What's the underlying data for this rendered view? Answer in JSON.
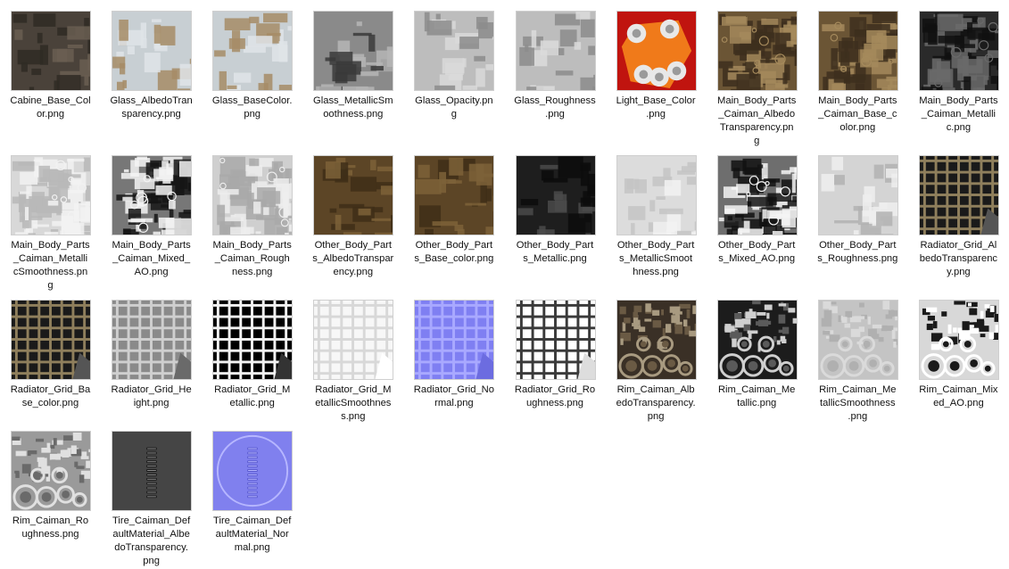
{
  "files": [
    {
      "name": "Cabine_Base_Color.png",
      "icon": "texture-dark-brown",
      "thumb": {
        "type": "panels",
        "bg": "#4a423a",
        "fg": "#2f2a25",
        "accent": "#6a5e52"
      }
    },
    {
      "name": "Glass_AlbedoTransparency.png",
      "icon": "texture-pale-blue",
      "thumb": {
        "type": "panels",
        "bg": "#c8cfd3",
        "fg": "#dfe4e7",
        "accent": "#a68c66"
      }
    },
    {
      "name": "Glass_BaseColor.png",
      "icon": "texture-pale-blue",
      "thumb": {
        "type": "panels",
        "bg": "#c8cfd3",
        "fg": "#dfe4e7",
        "accent": "#a68c66"
      }
    },
    {
      "name": "Glass_MetallicSmoothness.png",
      "icon": "texture-grey",
      "thumb": {
        "type": "panels",
        "bg": "#8a8a8a",
        "fg": "#b5b5b5",
        "accent": "#3a3a3a"
      }
    },
    {
      "name": "Glass_Opacity.png",
      "icon": "texture-light-grey",
      "thumb": {
        "type": "panels",
        "bg": "#bdbdbd",
        "fg": "#d9d9d9",
        "accent": "#8c8c8c"
      }
    },
    {
      "name": "Glass_Roughness.png",
      "icon": "texture-light-grey",
      "thumb": {
        "type": "panels",
        "bg": "#bdbdbd",
        "fg": "#dcdcdc",
        "accent": "#8c8c8c"
      }
    },
    {
      "name": "Light_Base_Color.png",
      "icon": "texture-red-orange",
      "thumb": {
        "type": "light",
        "bg": "#c0140f",
        "fg": "#f07a1a",
        "accent": "#e8e8e8"
      }
    },
    {
      "name": "Main_Body_Parts_Caiman_AlbedoTransparency.png",
      "icon": "texture-brown",
      "thumb": {
        "type": "detail",
        "bg": "#6b5535",
        "fg": "#3d2f1d",
        "accent": "#a58a5c"
      }
    },
    {
      "name": "Main_Body_Parts_Caiman_Base_color.png",
      "icon": "texture-brown",
      "thumb": {
        "type": "detail",
        "bg": "#6b5535",
        "fg": "#3d2f1d",
        "accent": "#a58a5c"
      }
    },
    {
      "name": "Main_Body_Parts_Caiman_Metallic.png",
      "icon": "texture-dark",
      "thumb": {
        "type": "detail",
        "bg": "#2a2a2a",
        "fg": "#111111",
        "accent": "#6a6a6a"
      }
    },
    {
      "name": "Main_Body_Parts_Caiman_MetallicSmoothness.png",
      "icon": "texture-light",
      "thumb": {
        "type": "detail",
        "bg": "#d8d8d8",
        "fg": "#b8b8b8",
        "accent": "#f2f2f2"
      }
    },
    {
      "name": "Main_Body_Parts_Caiman_Mixed_AO.png",
      "icon": "texture-bw",
      "thumb": {
        "type": "detail",
        "bg": "#777777",
        "fg": "#151515",
        "accent": "#f4f4f4"
      }
    },
    {
      "name": "Main_Body_Parts_Caiman_Roughness.png",
      "icon": "texture-light",
      "thumb": {
        "type": "detail",
        "bg": "#cfcfcf",
        "fg": "#a9a9a9",
        "accent": "#ededed"
      }
    },
    {
      "name": "Other_Body_Parts_AlbedoTransparency.png",
      "icon": "texture-brown",
      "thumb": {
        "type": "panels",
        "bg": "#5c4526",
        "fg": "#3e2e18",
        "accent": "#7d6238"
      }
    },
    {
      "name": "Other_Body_Parts_Base_color.png",
      "icon": "texture-brown",
      "thumb": {
        "type": "panels",
        "bg": "#5c4526",
        "fg": "#3e2e18",
        "accent": "#7d6238"
      }
    },
    {
      "name": "Other_Body_Parts_Metallic.png",
      "icon": "texture-dark",
      "thumb": {
        "type": "panels",
        "bg": "#1e1e1e",
        "fg": "#0c0c0c",
        "accent": "#4a4a4a"
      }
    },
    {
      "name": "Other_Body_Parts_MetallicSmoothness.png",
      "icon": "texture-light",
      "thumb": {
        "type": "panels",
        "bg": "#dcdcdc",
        "fg": "#c4c4c4",
        "accent": "#f2f2f2"
      }
    },
    {
      "name": "Other_Body_Parts_Mixed_AO.png",
      "icon": "texture-bw",
      "thumb": {
        "type": "detail",
        "bg": "#6e6e6e",
        "fg": "#121212",
        "accent": "#f4f4f4"
      }
    },
    {
      "name": "Other_Body_Parts_Roughness.png",
      "icon": "texture-light",
      "thumb": {
        "type": "panels",
        "bg": "#d4d4d4",
        "fg": "#b2b2b2",
        "accent": "#efefef"
      }
    },
    {
      "name": "Radiator_Grid_AlbedoTransparency.png",
      "icon": "texture-grid",
      "thumb": {
        "type": "grid",
        "bg": "#1a1a1a",
        "fg": "#8f7f5c",
        "accent": "#555555"
      }
    },
    {
      "name": "Radiator_Grid_Base_color.png",
      "icon": "texture-grid",
      "thumb": {
        "type": "grid",
        "bg": "#1a1a1a",
        "fg": "#8f7f5c",
        "accent": "#555555"
      }
    },
    {
      "name": "Radiator_Grid_Height.png",
      "icon": "texture-grid-grey",
      "thumb": {
        "type": "grid",
        "bg": "#8a8a8a",
        "fg": "#cfcfcf",
        "accent": "#6a6a6a"
      }
    },
    {
      "name": "Radiator_Grid_Metallic.png",
      "icon": "texture-grid-bw",
      "thumb": {
        "type": "grid",
        "bg": "#000000",
        "fg": "#f2f2f2",
        "accent": "#333333"
      }
    },
    {
      "name": "Radiator_Grid_MetallicSmoothness.png",
      "icon": "texture-grid-white",
      "thumb": {
        "type": "grid",
        "bg": "#f7f7f7",
        "fg": "#d8d8d8",
        "accent": "#ffffff"
      }
    },
    {
      "name": "Radiator_Grid_Normal.png",
      "icon": "texture-normal-grid",
      "thumb": {
        "type": "grid",
        "bg": "#7f7ff2",
        "fg": "#a9a9ff",
        "accent": "#6c6ce0"
      }
    },
    {
      "name": "Radiator_Grid_Roughness.png",
      "icon": "texture-grid-dark-lines",
      "thumb": {
        "type": "grid",
        "bg": "#ffffff",
        "fg": "#3a3a3a",
        "accent": "#dddddd"
      }
    },
    {
      "name": "Rim_Caiman_AlbedoTransparency.png",
      "icon": "texture-rim",
      "thumb": {
        "type": "rim",
        "bg": "#3a3026",
        "fg": "#6a5a44",
        "accent": "#a89a80"
      }
    },
    {
      "name": "Rim_Caiman_Metallic.png",
      "icon": "texture-rim-dark",
      "thumb": {
        "type": "rim",
        "bg": "#1c1c1c",
        "fg": "#5a5a5a",
        "accent": "#cfcfcf"
      }
    },
    {
      "name": "Rim_Caiman_MetallicSmoothness.png",
      "icon": "texture-rim-light",
      "thumb": {
        "type": "rim",
        "bg": "#c4c4c4",
        "fg": "#b0b0b0",
        "accent": "#dadada"
      }
    },
    {
      "name": "Rim_Caiman_Mixed_AO.png",
      "icon": "texture-rim-bw",
      "thumb": {
        "type": "rim",
        "bg": "#d8d8d8",
        "fg": "#1a1a1a",
        "accent": "#ffffff"
      }
    },
    {
      "name": "Rim_Caiman_Roughness.png",
      "icon": "texture-rim-grey",
      "thumb": {
        "type": "rim",
        "bg": "#9a9a9a",
        "fg": "#6a6a6a",
        "accent": "#e0e0e0"
      }
    },
    {
      "name": "Tire_Caiman_DefaultMaterial_AlbedoTransparency.png",
      "icon": "texture-tire",
      "thumb": {
        "type": "tire",
        "bg": "#454545",
        "fg": "#1a1a1a",
        "accent": "#8a8a8a"
      }
    },
    {
      "name": "Tire_Caiman_DefaultMaterial_Normal.png",
      "icon": "texture-tire-normal",
      "thumb": {
        "type": "tire",
        "bg": "#8080ee",
        "fg": "#5c5cd0",
        "accent": "#b6b6ff"
      }
    }
  ],
  "labels": [
    [
      "Cabine_Base_Col",
      "or.png"
    ],
    [
      "Glass_AlbedoTran",
      "sparency.png"
    ],
    [
      "Glass_BaseColor.",
      "png"
    ],
    [
      "Glass_MetallicSm",
      "oothness.png"
    ],
    [
      "Glass_Opacity.pn",
      "g"
    ],
    [
      "Glass_Roughness",
      ".png"
    ],
    [
      "Light_Base_Color",
      ".png"
    ],
    [
      "Main_Body_Parts",
      "_Caiman_Albedo",
      "Transparency.pn",
      "g"
    ],
    [
      "Main_Body_Parts",
      "_Caiman_Base_c",
      "olor.png"
    ],
    [
      "Main_Body_Parts",
      "_Caiman_Metalli",
      "c.png"
    ],
    [
      "Main_Body_Parts",
      "_Caiman_Metalli",
      "cSmoothness.pn",
      "g"
    ],
    [
      "Main_Body_Parts",
      "_Caiman_Mixed_",
      "AO.png"
    ],
    [
      "Main_Body_Parts",
      "_Caiman_Rough",
      "ness.png"
    ],
    [
      "Other_Body_Part",
      "s_AlbedoTranspar",
      "ency.png"
    ],
    [
      "Other_Body_Part",
      "s_Base_color.png"
    ],
    [
      "Other_Body_Part",
      "s_Metallic.png"
    ],
    [
      "Other_Body_Part",
      "s_MetallicSmoot",
      "hness.png"
    ],
    [
      "Other_Body_Part",
      "s_Mixed_AO.png"
    ],
    [
      "Other_Body_Part",
      "s_Roughness.png"
    ],
    [
      "Radiator_Grid_Al",
      "bedoTransparenc",
      "y.png"
    ],
    [
      "Radiator_Grid_Ba",
      "se_color.png"
    ],
    [
      "Radiator_Grid_He",
      "ight.png"
    ],
    [
      "Radiator_Grid_M",
      "etallic.png"
    ],
    [
      "Radiator_Grid_M",
      "etallicSmoothnes",
      "s.png"
    ],
    [
      "Radiator_Grid_No",
      "rmal.png"
    ],
    [
      "Radiator_Grid_Ro",
      "ughness.png"
    ],
    [
      "Rim_Caiman_Alb",
      "edoTransparency.",
      "png"
    ],
    [
      "Rim_Caiman_Me",
      "tallic.png"
    ],
    [
      "Rim_Caiman_Me",
      "tallicSmoothness",
      ".png"
    ],
    [
      "Rim_Caiman_Mix",
      "ed_AO.png"
    ],
    [
      "Rim_Caiman_Ro",
      "ughness.png"
    ],
    [
      "Tire_Caiman_Def",
      "aultMaterial_Albe",
      "doTransparency.",
      "png"
    ],
    [
      "Tire_Caiman_Def",
      "aultMaterial_Nor",
      "mal.png"
    ]
  ]
}
